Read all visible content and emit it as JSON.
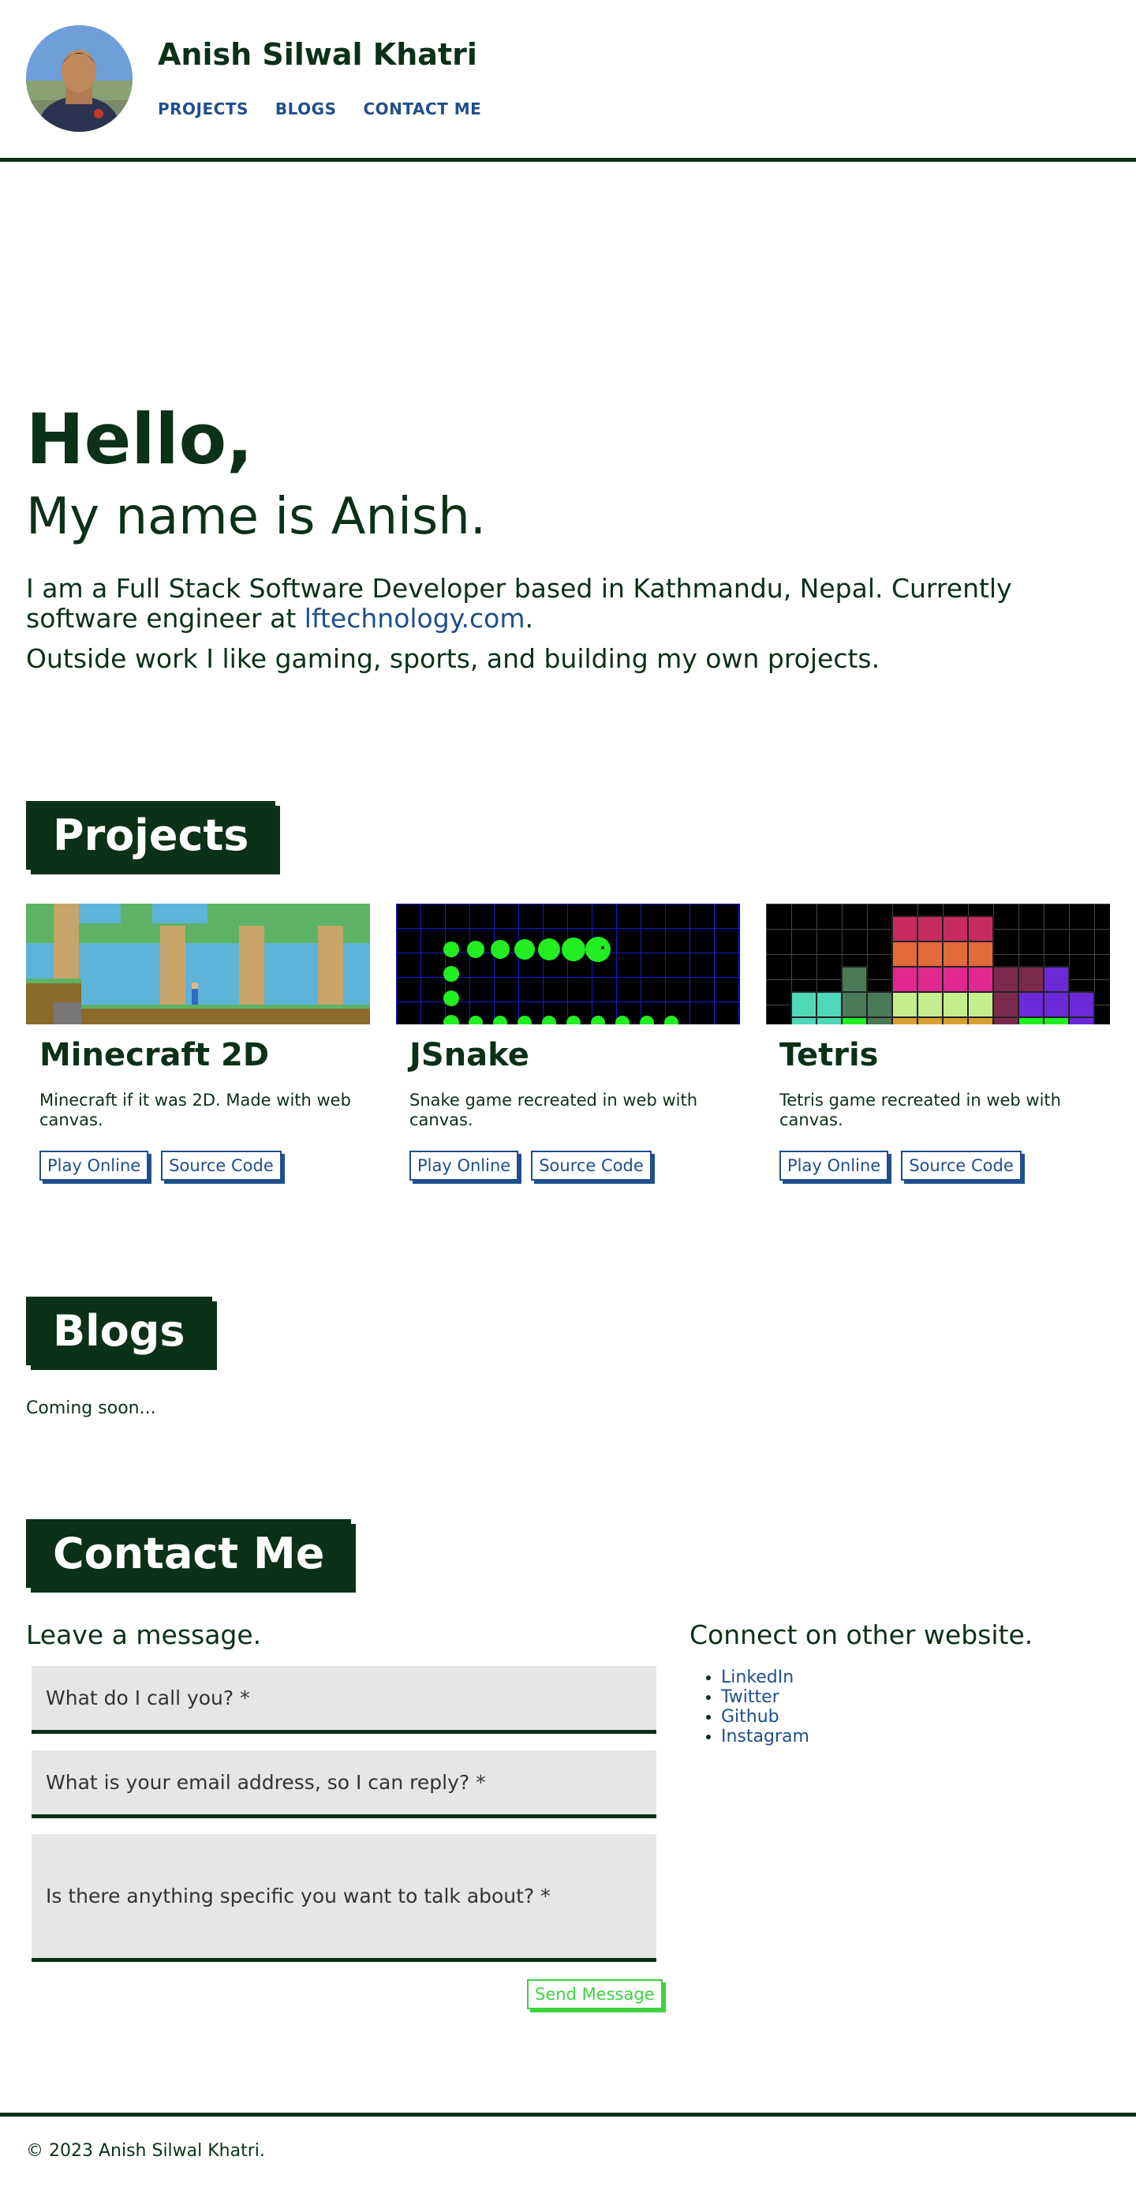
{
  "header": {
    "name": "Anish Silwal Khatri",
    "nav": [
      "PROJECTS",
      "BLOGS",
      "CONTACT ME"
    ]
  },
  "hero": {
    "greeting": "Hello,",
    "name_line": "My name is Anish.",
    "intro_before": "I am a Full Stack Software Developer based in Kathmandu, Nepal. Currently software engineer at ",
    "intro_link": "lftechnology.com",
    "intro_after": ".",
    "hobbies": "Outside work I like gaming, sports, and building my own projects."
  },
  "projects": {
    "title": "Projects",
    "items": [
      {
        "title": "Minecraft 2D",
        "description": "Minecraft if it was 2D. Made with web canvas.",
        "play": "Play Online",
        "source": "Source Code"
      },
      {
        "title": "JSnake",
        "description": "Snake game recreated in web with canvas.",
        "play": "Play Online",
        "source": "Source Code"
      },
      {
        "title": "Tetris",
        "description": "Tetris game recreated in web with canvas.",
        "play": "Play Online",
        "source": "Source Code"
      }
    ]
  },
  "blogs": {
    "title": "Blogs",
    "status": "Coming soon..."
  },
  "contact": {
    "title": "Contact Me",
    "leave_heading": "Leave a message.",
    "name_placeholder": "What do I call you? *",
    "email_placeholder": "What is your email address, so I can reply? *",
    "message_placeholder": "Is there anything specific you want to talk about? *",
    "send": "Send Message",
    "connect_heading": "Connect on other website.",
    "links": [
      "LinkedIn",
      "Twitter",
      "Github",
      "Instagram"
    ]
  },
  "footer": {
    "copyright": "© 2023 Anish Silwal Khatri."
  },
  "colors": {
    "primary": "#0b3118",
    "link": "#1f4e8c",
    "send": "#3fd23f",
    "field_bg": "#e6e6e6"
  }
}
